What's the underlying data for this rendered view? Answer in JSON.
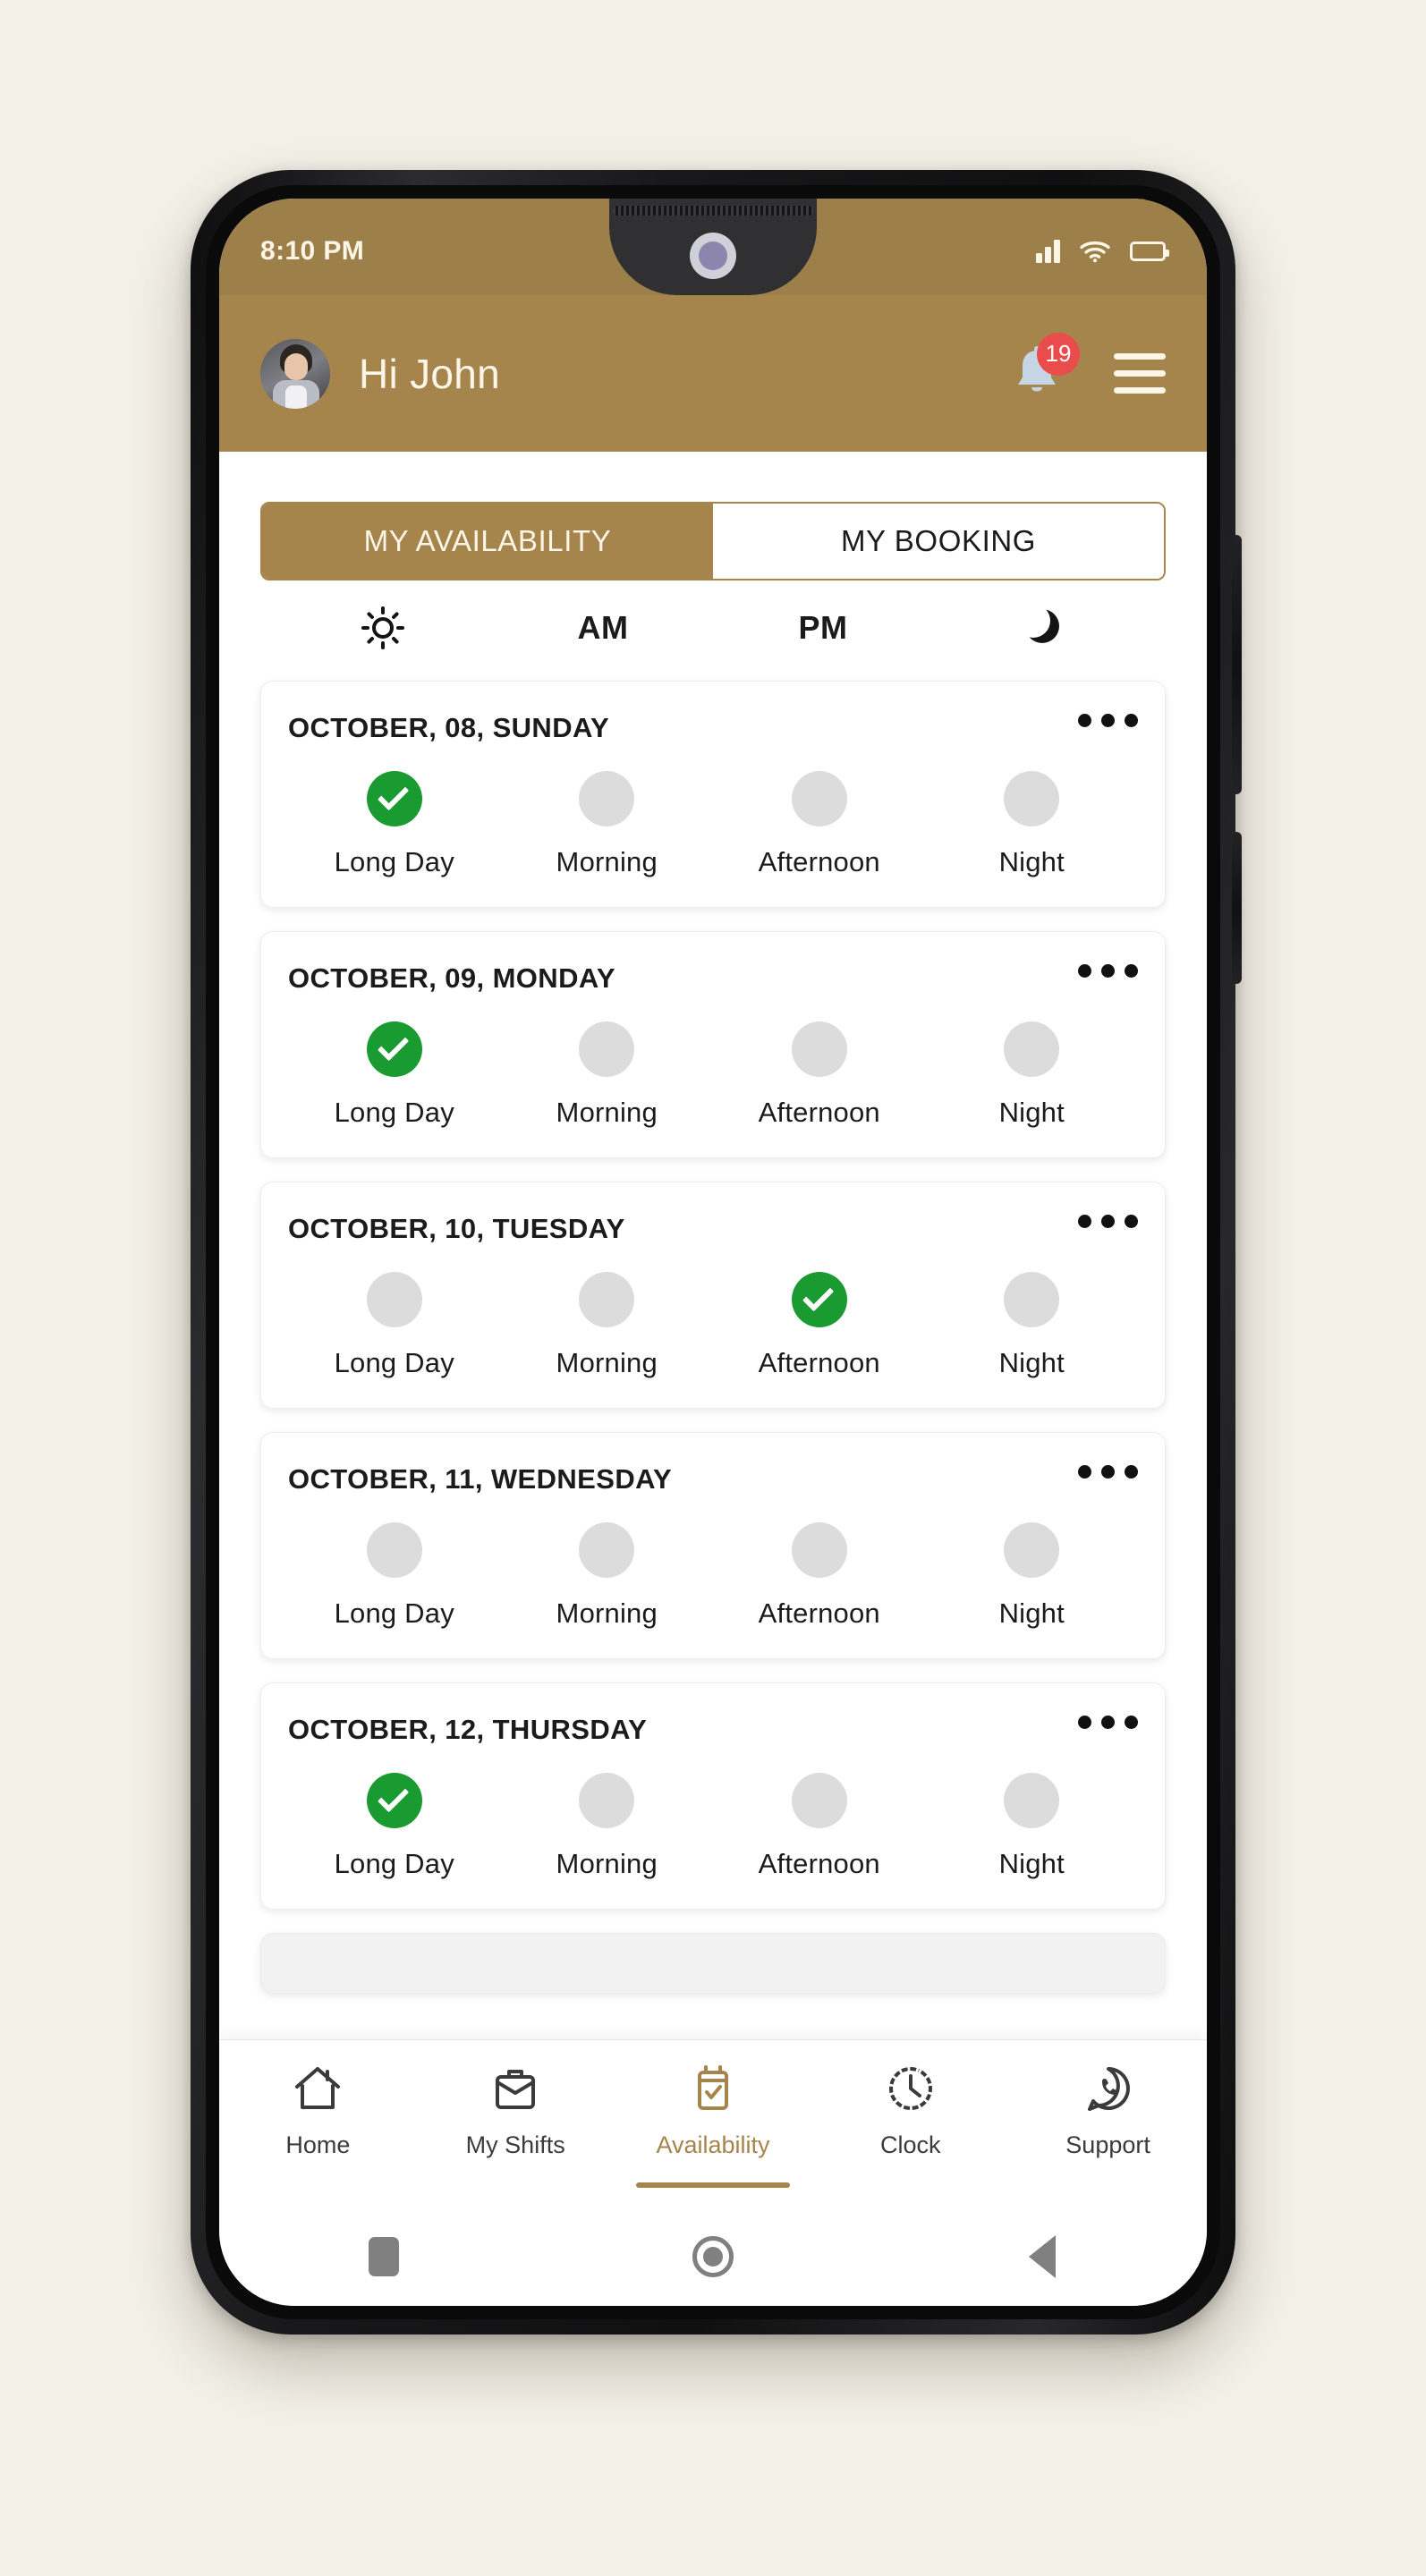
{
  "status_bar": {
    "time": "8:10 PM",
    "icons": [
      "signal-icon",
      "wifi-icon",
      "battery-icon"
    ]
  },
  "header": {
    "greeting": "Hi John",
    "avatar_name": "user-avatar",
    "notification_badge": "19",
    "bell_icon": "bell-icon",
    "menu_icon": "hamburger-menu-icon"
  },
  "tabs": [
    {
      "label": "MY AVAILABILITY",
      "active": true
    },
    {
      "label": "MY BOOKING",
      "active": false
    }
  ],
  "period_headers": [
    {
      "label": "",
      "icon": "sun-icon"
    },
    {
      "label": "AM",
      "icon": ""
    },
    {
      "label": "PM",
      "icon": ""
    },
    {
      "label": "",
      "icon": "moon-icon"
    }
  ],
  "slot_names": [
    "Long Day",
    "Morning",
    "Afternoon",
    "Night"
  ],
  "days": [
    {
      "title": "OCTOBER, 08, SUNDAY",
      "selected": [
        true,
        false,
        false,
        false
      ]
    },
    {
      "title": "OCTOBER, 09, MONDAY",
      "selected": [
        true,
        false,
        false,
        false
      ]
    },
    {
      "title": "OCTOBER, 10, TUESDAY",
      "selected": [
        false,
        false,
        true,
        false
      ]
    },
    {
      "title": "OCTOBER, 11, WEDNESDAY",
      "selected": [
        false,
        false,
        false,
        false
      ]
    },
    {
      "title": "OCTOBER, 12, THURSDAY",
      "selected": [
        true,
        false,
        false,
        false
      ]
    }
  ],
  "bottom_nav": [
    {
      "label": "Home",
      "icon": "home-icon",
      "active": false
    },
    {
      "label": "My Shifts",
      "icon": "briefcase-icon",
      "active": false
    },
    {
      "label": "Availability",
      "icon": "calendar-check-icon",
      "active": true
    },
    {
      "label": "Clock",
      "icon": "clock-icon",
      "active": false
    },
    {
      "label": "Support",
      "icon": "whatsapp-icon",
      "active": false
    }
  ],
  "system_nav": [
    {
      "name": "recents-button"
    },
    {
      "name": "home-button"
    },
    {
      "name": "back-button"
    }
  ],
  "colors": {
    "gold": "#a5854c",
    "status_gold": "#9d8049",
    "green": "#199b31",
    "badge_red": "#ea4c4c",
    "slot_grey": "#dcdcdc",
    "page_bg": "#f4f1e9"
  }
}
